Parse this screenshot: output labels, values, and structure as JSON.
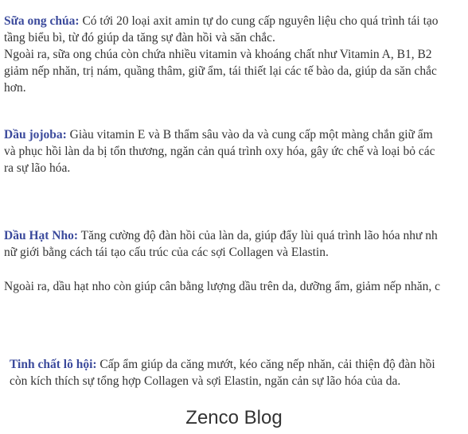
{
  "sections": [
    {
      "term": "Sữa ong chúa:",
      "line1": " Có tới 20 loại axit amin tự do cung cấp nguyên liệu cho quá trình tái tạo",
      "line2": "tầng biểu bì, từ đó giúp da tăng sự đàn hồi và săn chắc.",
      "line3": "Ngoài ra, sữa ong chúa còn chứa nhiều vitamin và khoáng chất như Vitamin A, B1, B2",
      "line4": "giảm nếp nhăn, trị nám, quầng thâm, giữ ẩm, tái thiết lại các tế bào da, giúp da săn chắc",
      "line5": "hơn."
    },
    {
      "term": "Dầu jojoba:",
      "line1": " Giàu vitamin E và B thẩm sâu vào da và cung cấp một màng chắn giữ ẩm",
      "line2": "và phục hồi làn da bị tổn thương, ngăn cản quá trình oxy hóa, gây ức chế và loại bỏ các",
      "line3": "ra sự lão hóa."
    },
    {
      "term": "Dầu Hạt Nho:",
      "line1": " Tăng cường độ đàn hồi của làn da, giúp đẩy lùi quá trình lão hóa như nh",
      "line2": "nữ giới bằng cách tái tạo cấu trúc của các sợi Collagen và Elastin.",
      "para2": "Ngoài ra, dầu hạt nho còn giúp cân bằng lượng dầu trên da, dưỡng ẩm, giảm nếp nhăn, c"
    },
    {
      "term": "Tinh chất lô hội:",
      "line1": " Cấp ẩm giúp da căng mướt, kéo căng nếp nhăn, cải thiện độ đàn hồi",
      "line2": "còn kích thích sự tổng hợp Collagen và sợi Elastin, ngăn cản sự lão hóa của da."
    }
  ],
  "footer": {
    "brand": "Zenco Blog"
  },
  "colors": {
    "term": "#3b4a9c",
    "text": "#333333",
    "background": "#ffffff"
  }
}
